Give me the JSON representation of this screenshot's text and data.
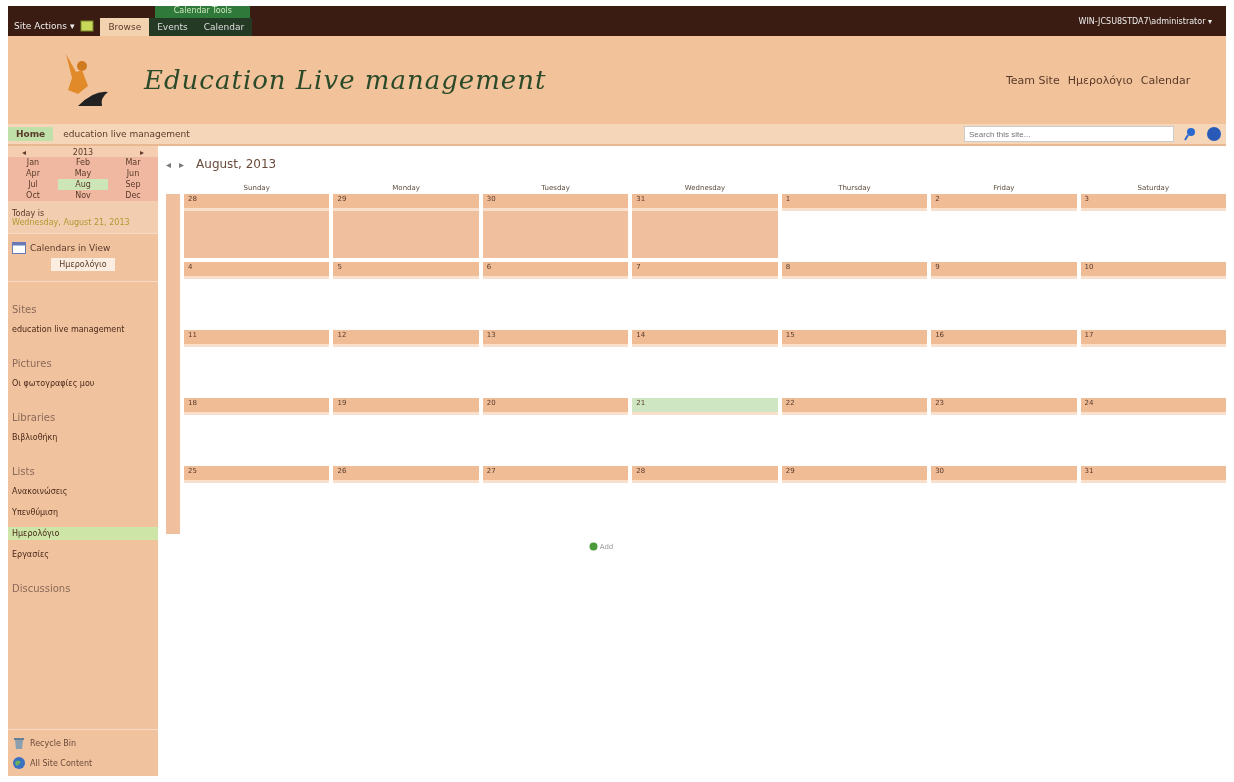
{
  "top_bar": {
    "site_actions": "Site Actions ▾",
    "tabs": [
      {
        "label": "Browse",
        "selected": true
      },
      {
        "label": "Events",
        "selected": false
      },
      {
        "label": "Calendar",
        "selected": false
      }
    ],
    "tools_group": "Calendar Tools",
    "user": "WIN-JCSU8STDA7\\administrator ▾"
  },
  "header": {
    "title": "Education Live management",
    "breadcrumb": [
      "Team Site",
      "Ημερολόγιο",
      "Calendar"
    ]
  },
  "nav_bar": {
    "home": "Home",
    "site": "education live management",
    "search": {
      "placeholder": "Search this site..."
    }
  },
  "mini_calendar": {
    "year": "2013",
    "prev": "◂",
    "next": "▸",
    "months": [
      {
        "label": "Jan",
        "selected": false
      },
      {
        "label": "Feb",
        "selected": false
      },
      {
        "label": "Mar",
        "selected": false
      },
      {
        "label": "Apr",
        "selected": false
      },
      {
        "label": "May",
        "selected": false
      },
      {
        "label": "Jun",
        "selected": false
      },
      {
        "label": "Jul",
        "selected": false
      },
      {
        "label": "Aug",
        "selected": true
      },
      {
        "label": "Sep",
        "selected": false
      },
      {
        "label": "Oct",
        "selected": false
      },
      {
        "label": "Nov",
        "selected": false
      },
      {
        "label": "Dec",
        "selected": false
      }
    ]
  },
  "today": {
    "prefix": "Today is",
    "date": "Wednesday, August 21, 2013"
  },
  "calendars_in_view": {
    "label": "Calendars in View",
    "item": "Ημερολόγιο"
  },
  "sidebar": [
    {
      "heading": "Sites",
      "items": [
        {
          "label": "education live management",
          "selected": false
        }
      ]
    },
    {
      "heading": "Pictures",
      "items": [
        {
          "label": "Οι φωτογραφίες μου",
          "selected": false
        }
      ]
    },
    {
      "heading": "Libraries",
      "items": [
        {
          "label": "Βιβλιοθήκη",
          "selected": false
        }
      ]
    },
    {
      "heading": "Lists",
      "items": [
        {
          "label": "Ανακοινώσεις",
          "selected": false
        },
        {
          "label": "Υπενθύμιση",
          "selected": false
        },
        {
          "label": "Ημερολόγιο",
          "selected": true
        },
        {
          "label": "Εργασίες",
          "selected": false
        }
      ]
    },
    {
      "heading": "Discussions"
    }
  ],
  "sidebar_footer": [
    {
      "kind": "recycle",
      "label": "Recycle Bin"
    },
    {
      "kind": "content",
      "label": "All Site Content"
    }
  ],
  "calendar": {
    "prev": "◂",
    "next": "▸",
    "title": "August, 2013",
    "weekdays": [
      "Sunday",
      "Monday",
      "Tuesday",
      "Wednesday",
      "Thursday",
      "Friday",
      "Saturday"
    ],
    "weeks": [
      [
        {
          "day": "28",
          "other_month": true,
          "today": false
        },
        {
          "day": "29",
          "other_month": true,
          "today": false
        },
        {
          "day": "30",
          "other_month": true,
          "today": false
        },
        {
          "day": "31",
          "other_month": true,
          "today": false
        },
        {
          "day": "1",
          "other_month": false,
          "today": false
        },
        {
          "day": "2",
          "other_month": false,
          "today": false
        },
        {
          "day": "3",
          "other_month": false,
          "today": false
        }
      ],
      [
        {
          "day": "4",
          "other_month": false,
          "today": false
        },
        {
          "day": "5",
          "other_month": false,
          "today": false
        },
        {
          "day": "6",
          "other_month": false,
          "today": false
        },
        {
          "day": "7",
          "other_month": false,
          "today": false
        },
        {
          "day": "8",
          "other_month": false,
          "today": false
        },
        {
          "day": "9",
          "other_month": false,
          "today": false
        },
        {
          "day": "10",
          "other_month": false,
          "today": false
        }
      ],
      [
        {
          "day": "11",
          "other_month": false,
          "today": false
        },
        {
          "day": "12",
          "other_month": false,
          "today": false
        },
        {
          "day": "13",
          "other_month": false,
          "today": false
        },
        {
          "day": "14",
          "other_month": false,
          "today": false
        },
        {
          "day": "15",
          "other_month": false,
          "today": false
        },
        {
          "day": "16",
          "other_month": false,
          "today": false
        },
        {
          "day": "17",
          "other_month": false,
          "today": false
        }
      ],
      [
        {
          "day": "18",
          "other_month": false,
          "today": false
        },
        {
          "day": "19",
          "other_month": false,
          "today": false
        },
        {
          "day": "20",
          "other_month": false,
          "today": false
        },
        {
          "day": "21",
          "other_month": false,
          "today": true
        },
        {
          "day": "22",
          "other_month": false,
          "today": false
        },
        {
          "day": "23",
          "other_month": false,
          "today": false
        },
        {
          "day": "24",
          "other_month": false,
          "today": false
        }
      ],
      [
        {
          "day": "25",
          "other_month": false,
          "today": false
        },
        {
          "day": "26",
          "other_month": false,
          "today": false
        },
        {
          "day": "27",
          "other_month": false,
          "today": false
        },
        {
          "day": "28",
          "other_month": false,
          "today": false
        },
        {
          "day": "29",
          "other_month": false,
          "today": false
        },
        {
          "day": "30",
          "other_month": false,
          "today": false
        },
        {
          "day": "31",
          "other_month": false,
          "today": false
        }
      ]
    ],
    "add": "Add"
  }
}
